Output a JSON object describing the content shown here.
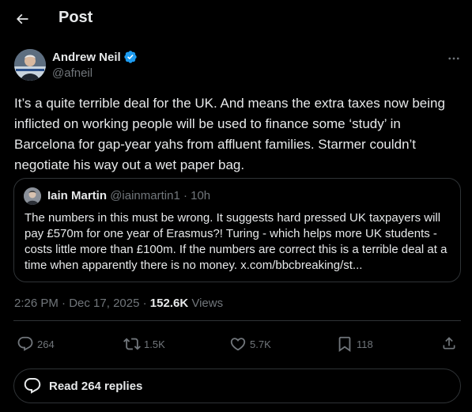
{
  "header": {
    "title": "Post",
    "back_icon": "arrow-left-icon"
  },
  "post": {
    "author": {
      "name": "Andrew Neil",
      "handle": "@afneil",
      "verified": true
    },
    "text": "It’s a quite terrible deal for the UK. And means the extra taxes now being inflicted on working people will be used to finance some ‘study’ in Barcelona for gap-year yahs from affluent families. Starmer couldn’t negotiate his way out a wet paper bag.",
    "quote": {
      "author_name": "Iain Martin",
      "handle": "@iainmartin1",
      "separator": "·",
      "time": "10h",
      "text": "The numbers in this must be wrong. It suggests hard pressed UK taxpayers will pay £570m for one year of Erasmus?! Turing - which helps more UK students - costs little more than £100m. If the numbers are correct this is a terrible deal at a time when apparently there is no money. x.com/bbcbreaking/st..."
    },
    "meta": {
      "time": "2:26 PM",
      "separator1": "·",
      "date": "Dec 17, 2025",
      "separator2": "·",
      "views_count": "152.6K",
      "views_label": "Views"
    },
    "actions": {
      "replies": "264",
      "reposts": "1.5K",
      "likes": "5.7K",
      "bookmarks": "118"
    },
    "read_replies_label": "Read 264 replies"
  },
  "colors": {
    "background": "#000000",
    "text_primary": "#e7e9ea",
    "text_secondary": "#71767b",
    "border": "#2f3336",
    "verified_blue": "#1d9bf0"
  }
}
